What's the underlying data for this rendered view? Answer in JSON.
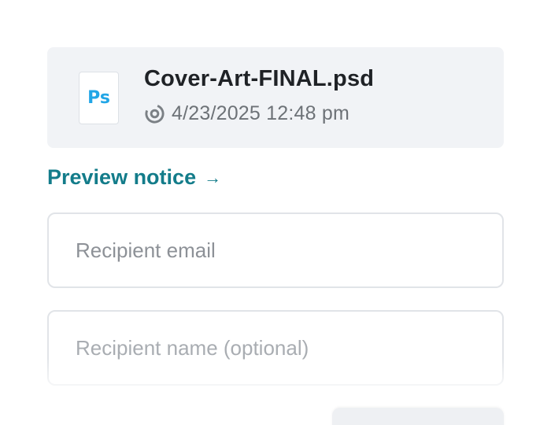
{
  "file": {
    "name": "Cover-Art-FINAL.psd",
    "type_label": "Ps",
    "timestamp": "4/23/2025 12:48 pm",
    "icon": "photoshop-file-icon",
    "time_icon": "clock-icon"
  },
  "preview_link": {
    "label": "Preview notice",
    "arrow": "→"
  },
  "form": {
    "recipient_email": {
      "value": "",
      "placeholder": "Recipient email"
    },
    "recipient_name": {
      "value": "",
      "placeholder": "Recipient name (optional)"
    }
  },
  "colors": {
    "accent": "#137c8a",
    "card_bg": "#f1f3f6",
    "photoshop_blue": "#22a6e6"
  }
}
